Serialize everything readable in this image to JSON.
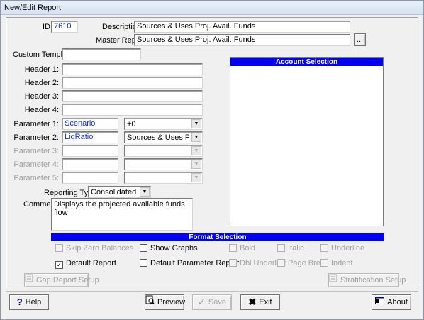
{
  "window": {
    "title": "New/Edit Report"
  },
  "form": {
    "id_label": "ID:",
    "id_value": "7610",
    "description_label": "Description:",
    "description_value": "Sources & Uses Proj. Avail. Funds",
    "master_report_label": "Master Report:",
    "master_report_value": "Sources & Uses Proj. Avail. Funds",
    "browse_label": "...",
    "custom_template_label": "Custom Template:",
    "custom_template_value": "",
    "header_labels": [
      "Header 1:",
      "Header 2:",
      "Header 3:",
      "Header 4:"
    ],
    "header_values": [
      "",
      "",
      "",
      ""
    ],
    "parameters": [
      {
        "label": "Parameter 1:",
        "value": "Scenario",
        "option": "+0",
        "enabled": true
      },
      {
        "label": "Parameter 2:",
        "value": "LiqRatio",
        "option": "Sources & Uses Proj. Avai",
        "enabled": true
      },
      {
        "label": "Parameter 3:",
        "value": "",
        "option": "",
        "enabled": false
      },
      {
        "label": "Parameter 4:",
        "value": "",
        "option": "",
        "enabled": false
      },
      {
        "label": "Parameter 5:",
        "value": "",
        "option": "",
        "enabled": false
      }
    ],
    "reporting_type_label": "Reporting Type:",
    "reporting_type_value": "Consolidated",
    "comment_label": "Comment:",
    "comment_value": "Displays the projected available funds flow"
  },
  "account_selection": {
    "title": "Account Selection"
  },
  "format_selection": {
    "title": "Format Selection",
    "options": [
      {
        "label": "Skip Zero Balances",
        "checked": false,
        "enabled": false
      },
      {
        "label": "Show Graphs",
        "checked": false,
        "enabled": true
      },
      {
        "label": "Bold",
        "checked": false,
        "enabled": false
      },
      {
        "label": "Italic",
        "checked": false,
        "enabled": false
      },
      {
        "label": "Underline",
        "checked": false,
        "enabled": false
      },
      {
        "label": "Default Report",
        "checked": true,
        "enabled": true
      },
      {
        "label": "Default Parameter Report",
        "checked": false,
        "enabled": true
      },
      {
        "label": "Dbl Underline",
        "checked": false,
        "enabled": false
      },
      {
        "label": "Page Break",
        "checked": false,
        "enabled": false
      },
      {
        "label": "Indent",
        "checked": false,
        "enabled": false
      }
    ]
  },
  "buttons": {
    "gap_report_setup": "Gap Report Setup",
    "stratification_setup": "Stratification Setup",
    "help": "Help",
    "preview": "Preview",
    "save": "Save",
    "exit": "Exit",
    "about": "About"
  },
  "icons": {
    "help": "question-icon",
    "preview": "magnifier-icon",
    "save": "checkmark-icon",
    "exit": "x-icon",
    "about": "about-icon"
  },
  "colors": {
    "header_blue": "#0000f0",
    "value_blue": "#1030d0"
  }
}
